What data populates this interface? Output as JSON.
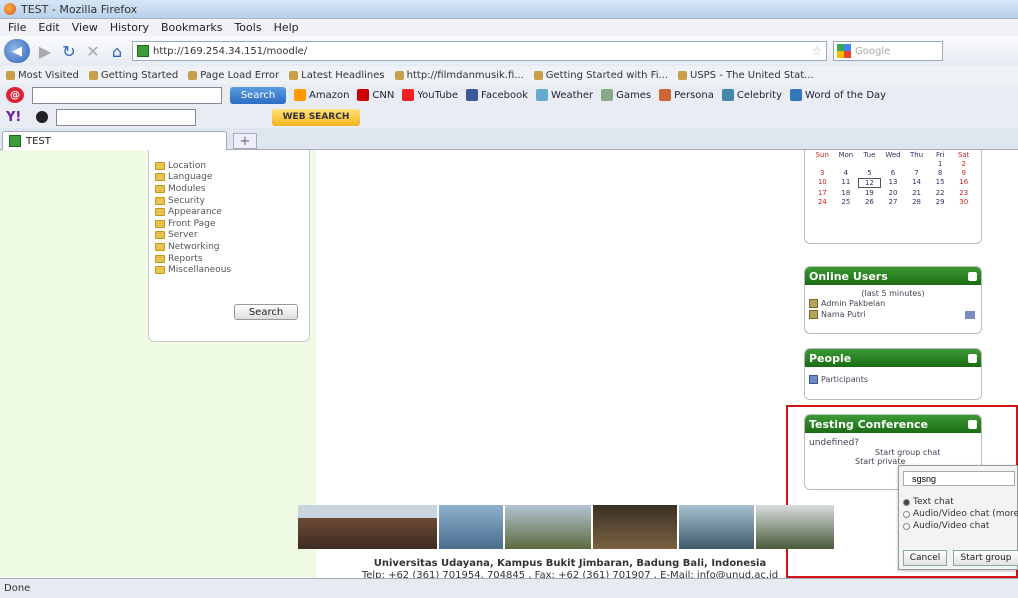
{
  "window": {
    "title": "TEST - Mozilla Firefox"
  },
  "menu": {
    "items": [
      "File",
      "Edit",
      "View",
      "History",
      "Bookmarks",
      "Tools",
      "Help"
    ]
  },
  "nav": {
    "url": "http://169.254.34.151/moodle/",
    "search_placeholder": "Google"
  },
  "bookmarks": {
    "items": [
      "Most Visited",
      "Getting Started",
      "Page Load Error",
      "Latest Headlines",
      "http://filmdanmusik.fi...",
      "Getting Started with Fi...",
      "USPS - The United Stat..."
    ]
  },
  "ask_toolbar": {
    "search_label": "Search",
    "items": [
      "Amazon",
      "CNN",
      "YouTube",
      "Facebook",
      "Weather",
      "Games",
      "Persona",
      "Celebrity",
      "Word of the Day"
    ]
  },
  "yahoo_toolbar": {
    "websearch_label": "WEB SEARCH"
  },
  "tabs": {
    "active": "TEST"
  },
  "admin": {
    "items": [
      "Location",
      "Language",
      "Modules",
      "Security",
      "Appearance",
      "Front Page",
      "Server",
      "Networking",
      "Reports",
      "Miscellaneous"
    ],
    "search_button": "Search"
  },
  "calendar": {
    "days": [
      "Sun",
      "Mon",
      "Tue",
      "Wed",
      "Thu",
      "Fri",
      "Sat"
    ],
    "dates": [
      "",
      "",
      "",
      "",
      "",
      "1",
      "2",
      "3",
      "4",
      "5",
      "6",
      "7",
      "8",
      "9",
      "10",
      "11",
      "12",
      "13",
      "14",
      "15",
      "16",
      "17",
      "18",
      "19",
      "20",
      "21",
      "22",
      "23",
      "24",
      "25",
      "26",
      "27",
      "28",
      "29",
      "30"
    ],
    "today": "12"
  },
  "online_users": {
    "title": "Online Users",
    "subtitle": "(last 5 minutes)",
    "users": [
      "Admin Pakbelan",
      "Nama Putri"
    ]
  },
  "people": {
    "title": "People",
    "participants": "Participants"
  },
  "conference": {
    "title": "Testing Conference",
    "label": "undefined?",
    "start_group_chat": "Start group chat",
    "start_chat": "Start private"
  },
  "chat_popup": {
    "topic": "sgsng",
    "options": [
      "Text chat",
      "Audio/Video chat (more)",
      "Audio/Video chat"
    ],
    "selected": "Text chat",
    "cancel": "Cancel",
    "start_group": "Start group"
  },
  "footer": {
    "line1": "Universitas Udayana, Kampus Bukit Jimbaran, Badung Bali, Indonesia",
    "line2": "Telp: +62 (361) 701954, 704845 , Fax: +62 (361) 701907 , E-Mail: info@unud.ac.id"
  },
  "status": {
    "text": "Done"
  },
  "colors": {
    "block_header": "#1b6b14",
    "page_bg": "#f0fbe6",
    "highlight": "#d0141a"
  }
}
